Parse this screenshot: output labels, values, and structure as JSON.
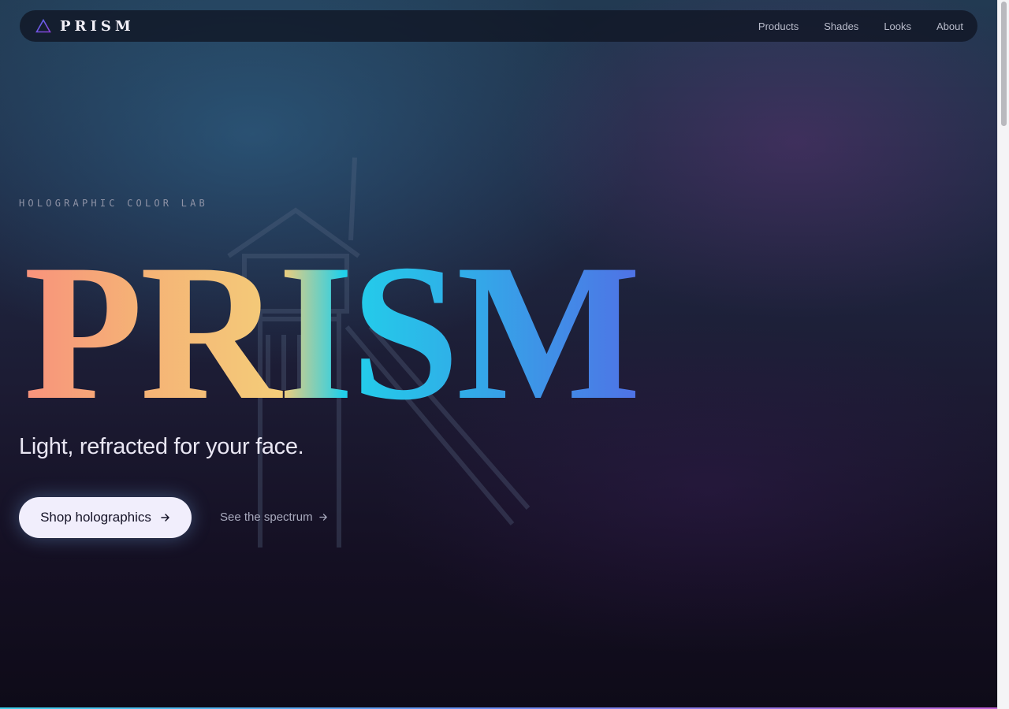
{
  "nav": {
    "brand": "PRISM",
    "links": [
      "Products",
      "Shades",
      "Looks",
      "About"
    ]
  },
  "hero": {
    "eyebrow": "HOLOGRAPHIC COLOR LAB",
    "title": "PRISM",
    "tagline": "Light, refracted for your face.",
    "cta_primary": "Shop holographics",
    "cta_secondary": "See the spectrum"
  },
  "colors": {
    "gradient_start": "#f8927c",
    "gradient_mid": "#f4cd79",
    "gradient_cyan": "#22d0ea",
    "gradient_end": "#4f72e6",
    "background": "#0f0d1a",
    "button_bg": "#f1eefc"
  },
  "icons": {
    "brand": "triangle-prism-icon",
    "cta_primary": "arrow-right-icon",
    "cta_secondary": "arrow-right-icon"
  }
}
